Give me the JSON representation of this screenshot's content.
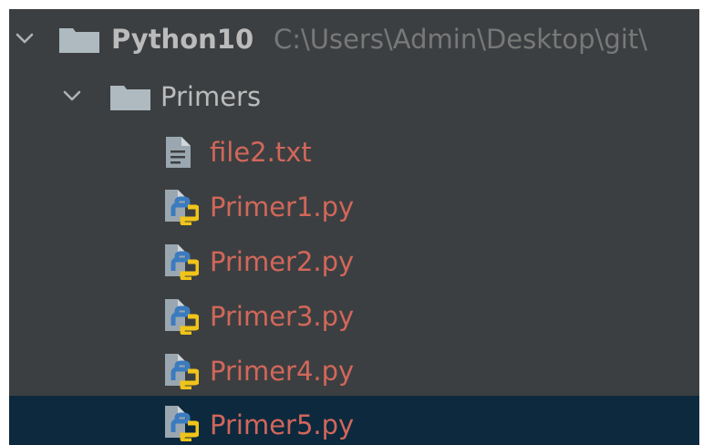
{
  "project_tree": {
    "root": {
      "name": "Python10",
      "path": "C:\\Users\\Admin\\Desktop\\git\\",
      "expanded": true,
      "icon": "folder-icon"
    },
    "folder": {
      "name": "Primers",
      "expanded": true,
      "icon": "folder-icon"
    },
    "files": [
      {
        "name": "file2.txt",
        "icon": "text-file-icon"
      },
      {
        "name": "Primer1.py",
        "icon": "python-file-icon"
      },
      {
        "name": "Primer2.py",
        "icon": "python-file-icon"
      },
      {
        "name": "Primer3.py",
        "icon": "python-file-icon"
      },
      {
        "name": "Primer4.py",
        "icon": "python-file-icon"
      },
      {
        "name": "Primer5.py",
        "icon": "python-file-icon",
        "selected": true
      }
    ],
    "colors": {
      "background": "#3c3f41",
      "selected_row": "#0d293e",
      "unversioned_file": "#d1675a",
      "folder_text": "#bbbbbb",
      "path_text": "#787878",
      "folder_icon": "#aeb9c0",
      "python_blue": "#3b7bbf",
      "python_yellow": "#f0c419"
    }
  }
}
